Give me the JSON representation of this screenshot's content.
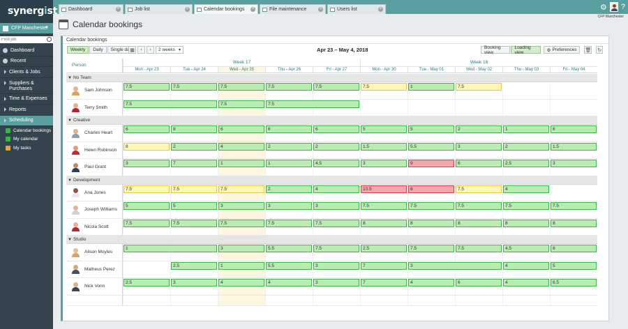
{
  "app": {
    "logo": "synergist",
    "tabs": [
      {
        "label": "Dashboard",
        "active": false
      },
      {
        "label": "Job list",
        "active": false
      },
      {
        "label": "Calendar bookings",
        "active": true
      },
      {
        "label": "File maintenance",
        "active": false
      },
      {
        "label": "Users list",
        "active": false
      }
    ],
    "user": "CFP Manchester",
    "icons": [
      "gear-icon",
      "help-icon"
    ]
  },
  "sidebar": {
    "site": "CFP Manchester",
    "find_placeholder": "Find job",
    "items": [
      {
        "label": "Dashboard",
        "icon": "dashboard-icon"
      },
      {
        "label": "Recent",
        "icon": "recent-icon"
      },
      {
        "label": "Clients & Jobs",
        "icon": "arrow"
      },
      {
        "label": "Suppliers & Purchases",
        "icon": "arrow"
      },
      {
        "label": "Time & Expenses",
        "icon": "arrow"
      },
      {
        "label": "Reports",
        "icon": "arrow"
      },
      {
        "label": "Scheduling",
        "icon": "arrow",
        "active": true
      }
    ],
    "subitems": [
      {
        "label": "Calendar bookings",
        "color": "#3db34a"
      },
      {
        "label": "My calendar",
        "color": "#3db34a"
      },
      {
        "label": "My tasks",
        "color": "#e8a03a"
      }
    ]
  },
  "page": {
    "title": "Calendar bookings",
    "panel_title": "Calendar bookings"
  },
  "toolbar": {
    "view_buttons": [
      "Weekly",
      "Daily",
      "Single day"
    ],
    "selected_view": "Weekly",
    "range_select": "2 weeks",
    "date_range": "Apr 23 – May 4, 2018",
    "booking_view": "Booking view",
    "loading_view": "Loading view",
    "preferences": "Preferences"
  },
  "grid": {
    "person_header": "Person",
    "weeks": [
      "Week 17",
      "Week 18"
    ],
    "days": [
      "Mon - Apr 23",
      "Tue - Apr 24",
      "Wed - Apr 25",
      "Thu - Apr 26",
      "Fri - Apr 27",
      "Mon - Apr 30",
      "Tue - May 01",
      "Wed - May 02",
      "Thu - May 03",
      "Fri - May 04"
    ],
    "today_index": 2,
    "teams": [
      {
        "name": "No Team",
        "people": [
          {
            "name": "Sam Johnson",
            "avatar": "female",
            "bookings": [
              [
                "7.5",
                "g"
              ],
              [
                "7.5",
                "g"
              ],
              [
                "7.5",
                "g"
              ],
              [
                "7.5",
                "g"
              ],
              [
                "7.5",
                "g"
              ],
              [
                "7.5",
                "y"
              ],
              [
                "1",
                "g"
              ],
              [
                "7.5",
                "y"
              ],
              null,
              null
            ]
          },
          {
            "name": "Terry Smith",
            "avatar": "female2",
            "bookings": [
              [
                "7.5",
                "g",
                2
              ],
              null,
              [
                "7.5",
                "g"
              ],
              [
                "7.5",
                "g",
                2
              ],
              null,
              null,
              null,
              null,
              null,
              null
            ]
          }
        ]
      },
      {
        "name": "Creative",
        "people": [
          {
            "name": "Charles Heart",
            "avatar": "male",
            "bookings": [
              [
                "6",
                "g"
              ],
              [
                "8",
                "g"
              ],
              [
                "6",
                "g"
              ],
              [
                "6",
                "g"
              ],
              [
                "6",
                "g"
              ],
              [
                "5",
                "g"
              ],
              [
                "5",
                "g"
              ],
              [
                "2",
                "g"
              ],
              [
                "1",
                "g"
              ],
              [
                "6",
                "g"
              ]
            ]
          },
          {
            "name": "Helen Robinson",
            "avatar": "female3",
            "bookings": [
              [
                "8",
                "y"
              ],
              [
                "2",
                "g"
              ],
              [
                "4",
                "g"
              ],
              [
                "2",
                "g"
              ],
              [
                "2",
                "g"
              ],
              [
                "1.5",
                "g"
              ],
              [
                "5.5",
                "g"
              ],
              [
                "3",
                "g"
              ],
              [
                "2",
                "g"
              ],
              [
                "1.5",
                "g"
              ]
            ]
          },
          {
            "name": "Paul Grant",
            "avatar": "male2",
            "bookings": [
              [
                "3",
                "g"
              ],
              [
                "7",
                "g"
              ],
              [
                "1",
                "g"
              ],
              [
                "1",
                "g"
              ],
              [
                "4.5",
                "g"
              ],
              [
                "3",
                "g"
              ],
              [
                "9",
                "r"
              ],
              [
                "6",
                "g"
              ],
              [
                "2.5",
                "g"
              ],
              [
                "3",
                "g"
              ]
            ]
          }
        ]
      },
      {
        "name": "Development",
        "people": [
          {
            "name": "Ana Jones",
            "avatar": "female4",
            "bookings": [
              [
                "7.5",
                "y"
              ],
              [
                "7.5",
                "y"
              ],
              [
                "7.5",
                "y"
              ],
              [
                "2",
                "g"
              ],
              [
                "4",
                "g"
              ],
              [
                "10.5",
                "r"
              ],
              [
                "8",
                "r"
              ],
              [
                "7.5",
                "y"
              ],
              [
                "4",
                "g"
              ],
              null
            ]
          },
          {
            "name": "Joseph Williams",
            "avatar": "male3",
            "bookings": [
              [
                "5",
                "g"
              ],
              [
                "5",
                "g"
              ],
              [
                "3",
                "g"
              ],
              [
                "3",
                "g"
              ],
              [
                "3",
                "g"
              ],
              [
                "7.5",
                "g"
              ],
              [
                "7.5",
                "g"
              ],
              [
                "7.5",
                "g"
              ],
              [
                "7.5",
                "g"
              ],
              [
                "7.5",
                "g"
              ]
            ]
          },
          {
            "name": "Nicola Scott",
            "avatar": "female5",
            "bookings": [
              [
                "7.5",
                "g"
              ],
              [
                "7.5",
                "g"
              ],
              [
                "7.5",
                "g"
              ],
              [
                "7.5",
                "g"
              ],
              [
                "7.5",
                "g"
              ],
              [
                "8",
                "g"
              ],
              [
                "8",
                "g"
              ],
              [
                "8",
                "g"
              ],
              [
                "8",
                "g"
              ],
              [
                "8",
                "g"
              ]
            ]
          }
        ]
      },
      {
        "name": "Studio",
        "people": [
          {
            "name": "Alison Moyles",
            "avatar": "female6",
            "bookings": [
              [
                "1",
                "g",
                2
              ],
              null,
              [
                "3",
                "g"
              ],
              [
                "5.5",
                "g"
              ],
              [
                "7.5",
                "g"
              ],
              [
                "2.5",
                "g"
              ],
              [
                "7.5",
                "g"
              ],
              [
                "7.5",
                "g"
              ],
              [
                "4.5",
                "g"
              ],
              [
                "8",
                "g"
              ]
            ]
          },
          {
            "name": "Matheus Perez",
            "avatar": "male4",
            "bookings": [
              null,
              [
                "2.5",
                "g"
              ],
              [
                "1",
                "g"
              ],
              [
                "5.5",
                "g"
              ],
              [
                "3",
                "g"
              ],
              [
                "7",
                "g"
              ],
              [
                "3",
                "g",
                2
              ],
              null,
              [
                "4",
                "g"
              ],
              [
                "5",
                "g"
              ]
            ]
          },
          {
            "name": "Nick Vonn",
            "avatar": "male5",
            "bookings": [
              [
                "2.5",
                "g"
              ],
              [
                "3",
                "g"
              ],
              [
                "4",
                "g"
              ],
              [
                "4",
                "g"
              ],
              [
                "3",
                "g"
              ],
              [
                "7",
                "g"
              ],
              [
                "4",
                "g"
              ],
              [
                "6",
                "g"
              ],
              [
                "4",
                "g"
              ],
              [
                "6.5",
                "g"
              ]
            ]
          }
        ]
      }
    ]
  }
}
